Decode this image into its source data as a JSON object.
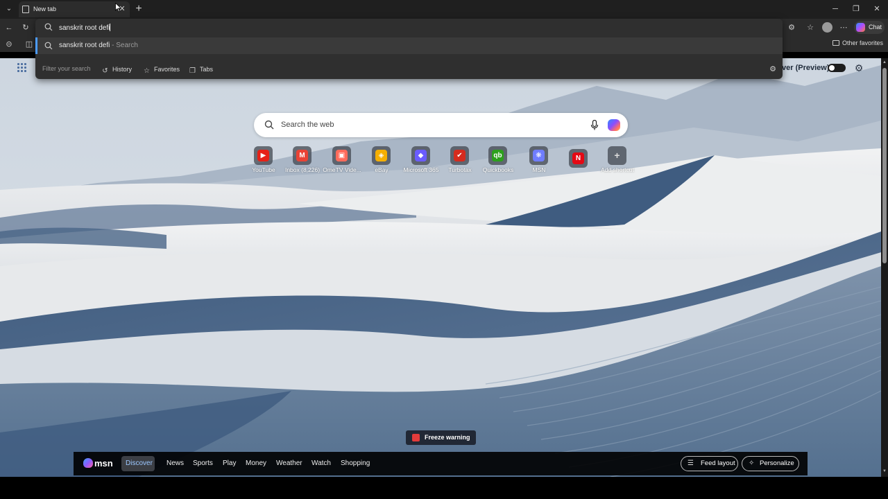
{
  "browser": {
    "tab": {
      "title": "New tab"
    },
    "chat_label": "Chat",
    "other_favorites": "Other favorites"
  },
  "omnibox": {
    "query": "sanskrit root defi",
    "suggestion": {
      "text": "sanskrit root defi",
      "suffix": " - Search"
    },
    "filter_placeholder": "Filter your search",
    "filters": [
      "History",
      "Favorites",
      "Tabs"
    ]
  },
  "page": {
    "discover_label": "ver (Preview)",
    "search_placeholder": "Search the web",
    "shortcuts": [
      {
        "label": "YouTube",
        "icon": "youtube-icon",
        "color": "#e62117"
      },
      {
        "label": "Inbox (8,226)",
        "icon": "gmail-icon",
        "color": "#ea4335"
      },
      {
        "label": "OmeTV Vide...",
        "icon": "ometv-icon",
        "color": "#ff6b5b"
      },
      {
        "label": "eBay",
        "icon": "ebay-icon",
        "color": "#f5af02"
      },
      {
        "label": "Microsoft 365",
        "icon": "m365-icon",
        "color": "#6a5cff"
      },
      {
        "label": "Turbotax",
        "icon": "turbotax-icon",
        "color": "#d52b1e"
      },
      {
        "label": "Quickbooks",
        "icon": "quickbooks-icon",
        "color": "#2ca01c"
      },
      {
        "label": "MSN",
        "icon": "msn-icon",
        "color": "#6f7dff"
      },
      {
        "label": "",
        "icon": "netflix-icon",
        "color": "#e50914"
      },
      {
        "label": "Add shortcut",
        "icon": "plus-icon",
        "color": "#6b7380"
      }
    ],
    "freeze_warning": "Freeze warning"
  },
  "msn": {
    "logo": "msn",
    "nav": [
      "Discover",
      "News",
      "Sports",
      "Play",
      "Money",
      "Weather",
      "Watch",
      "Shopping"
    ],
    "active_nav": "Discover",
    "feed_layout": "Feed layout",
    "personalize": "Personalize"
  }
}
